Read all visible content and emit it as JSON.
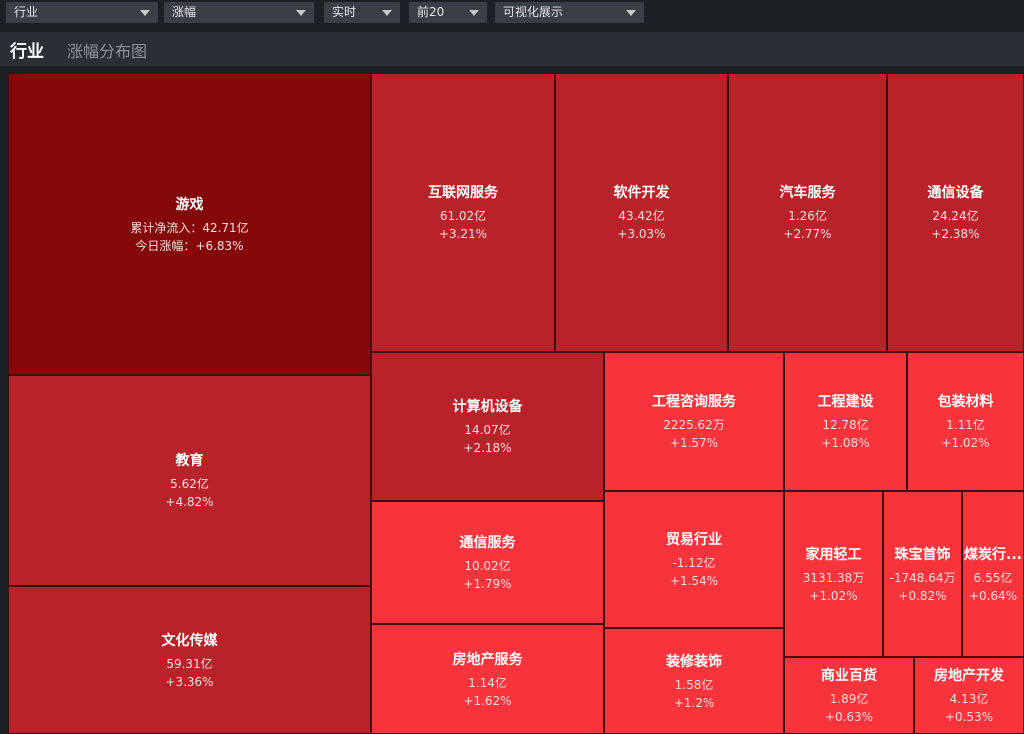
{
  "filters": {
    "category": "行业",
    "metric": "涨幅",
    "period": "实时",
    "top": "前20",
    "view": "可视化展示"
  },
  "header": {
    "title": "行业",
    "subtitle": "涨幅分布图"
  },
  "colors": {
    "deep": "#850808",
    "mid": "#b92229",
    "light": "#f7343b"
  },
  "featured": {
    "name": "游戏",
    "flow_label": "累计净流入：42.71亿",
    "change_label": "今日涨幅：+6.83%"
  },
  "tiles": [
    {
      "name": "互联网服务",
      "flow": "61.02亿",
      "change": "+3.21%"
    },
    {
      "name": "软件开发",
      "flow": "43.42亿",
      "change": "+3.03%"
    },
    {
      "name": "汽车服务",
      "flow": "1.26亿",
      "change": "+2.77%"
    },
    {
      "name": "通信设备",
      "flow": "24.24亿",
      "change": "+2.38%"
    },
    {
      "name": "教育",
      "flow": "5.62亿",
      "change": "+4.82%"
    },
    {
      "name": "文化传媒",
      "flow": "59.31亿",
      "change": "+3.36%"
    },
    {
      "name": "计算机设备",
      "flow": "14.07亿",
      "change": "+2.18%"
    },
    {
      "name": "工程咨询服务",
      "flow": "2225.62万",
      "change": "+1.57%"
    },
    {
      "name": "工程建设",
      "flow": "12.78亿",
      "change": "+1.08%"
    },
    {
      "name": "包装材料",
      "flow": "1.11亿",
      "change": "+1.02%"
    },
    {
      "name": "通信服务",
      "flow": "10.02亿",
      "change": "+1.79%"
    },
    {
      "name": "贸易行业",
      "flow": "-1.12亿",
      "change": "+1.54%"
    },
    {
      "name": "家用轻工",
      "flow": "3131.38万",
      "change": "+1.02%"
    },
    {
      "name": "珠宝首饰",
      "flow": "-1748.64万",
      "change": "+0.82%"
    },
    {
      "name": "煤炭行...",
      "flow": "6.55亿",
      "change": "+0.64%"
    },
    {
      "name": "房地产服务",
      "flow": "1.14亿",
      "change": "+1.62%"
    },
    {
      "name": "装修装饰",
      "flow": "1.58亿",
      "change": "+1.2%"
    },
    {
      "name": "商业百货",
      "flow": "1.89亿",
      "change": "+0.63%"
    },
    {
      "name": "房地产开发",
      "flow": "4.13亿",
      "change": "+0.53%"
    }
  ]
}
